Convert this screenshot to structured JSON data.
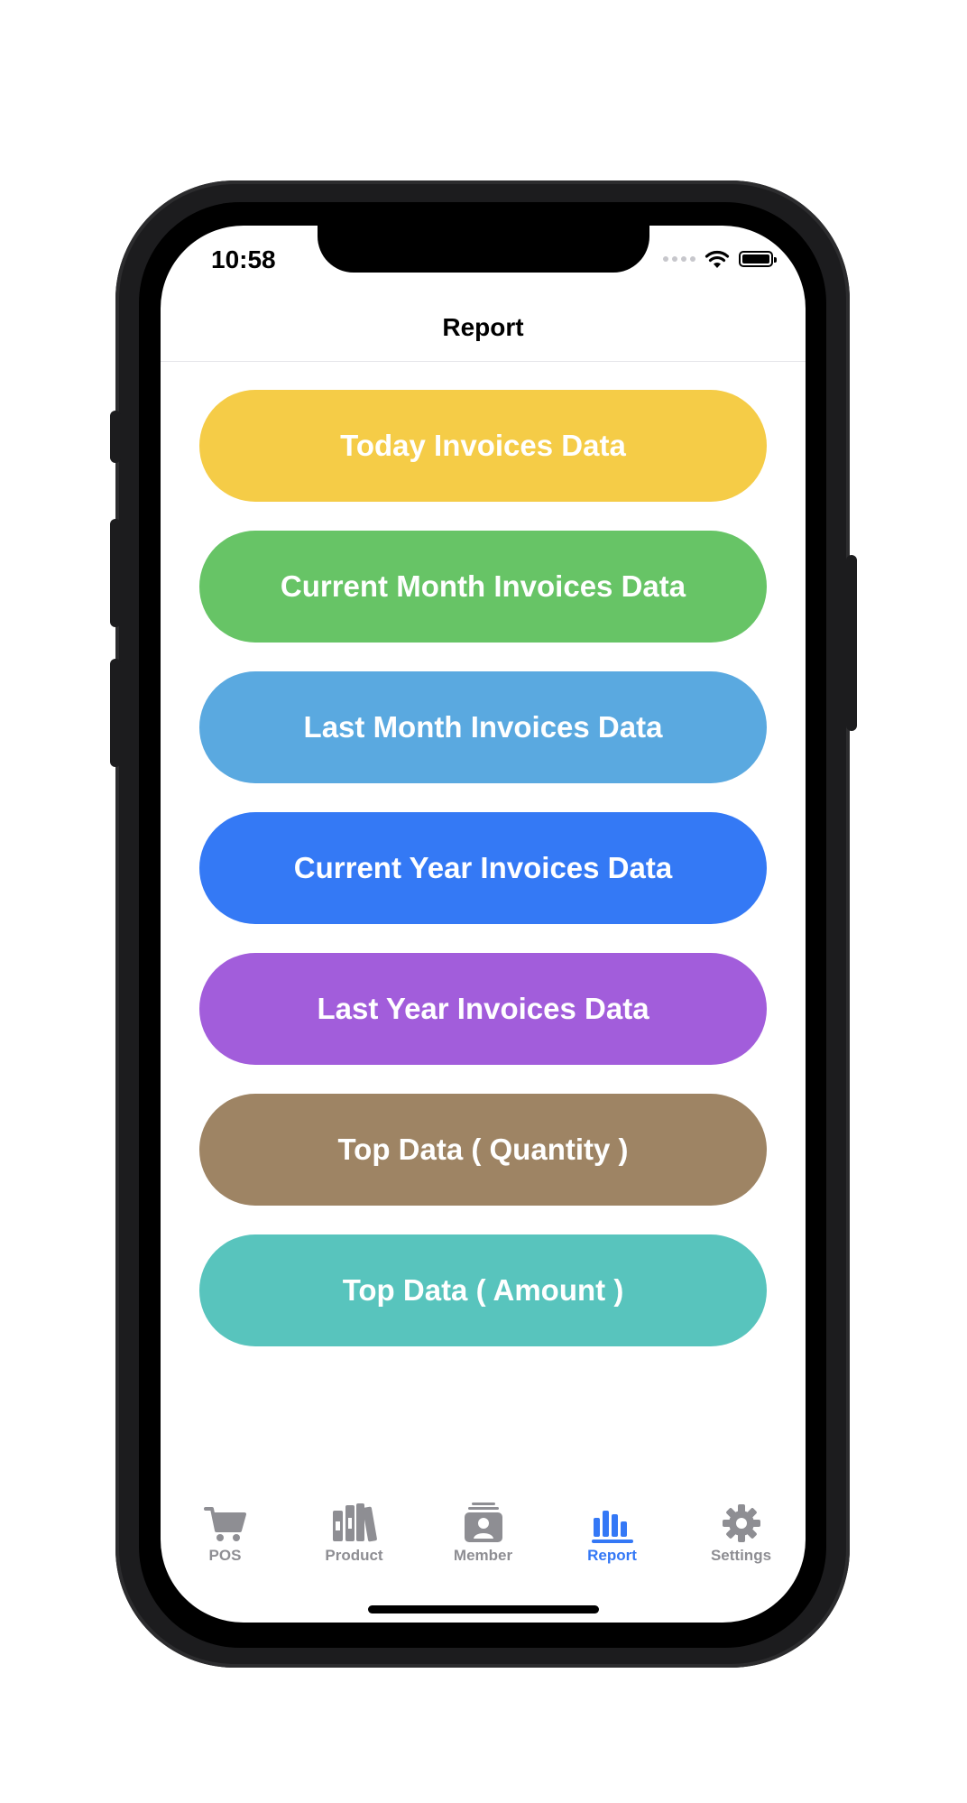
{
  "status_bar": {
    "time": "10:58"
  },
  "nav": {
    "title": "Report"
  },
  "buttons": [
    {
      "label": "Today Invoices Data",
      "color": "#f5cc47"
    },
    {
      "label": "Current Month Invoices Data",
      "color": "#67c466"
    },
    {
      "label": "Last Month Invoices Data",
      "color": "#5aa9e0"
    },
    {
      "label": "Current Year Invoices Data",
      "color": "#3479f5"
    },
    {
      "label": "Last Year Invoices Data",
      "color": "#a25ddb"
    },
    {
      "label": "Top Data ( Quantity )",
      "color": "#9e8464"
    },
    {
      "label": "Top Data ( Amount )",
      "color": "#58c4bd"
    }
  ],
  "tabbar": {
    "items": [
      {
        "label": "POS",
        "icon": "cart-icon"
      },
      {
        "label": "Product",
        "icon": "books-icon"
      },
      {
        "label": "Member",
        "icon": "contact-icon"
      },
      {
        "label": "Report",
        "icon": "bar-chart-icon"
      },
      {
        "label": "Settings",
        "icon": "gear-icon"
      }
    ],
    "active": "Report",
    "active_color": "#3478f6",
    "inactive_color": "#8e8e93"
  }
}
